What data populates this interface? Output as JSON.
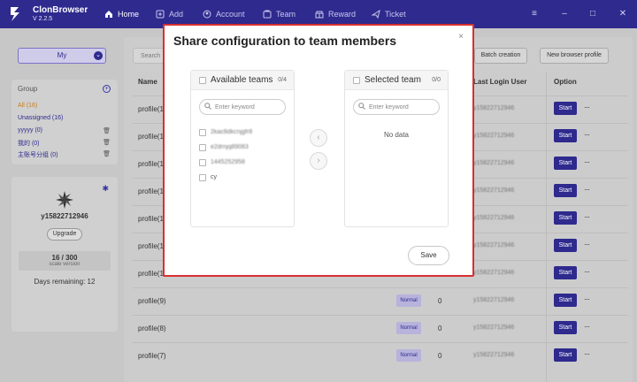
{
  "app": {
    "name": "ClonBrowser",
    "version": "V 2.2.5"
  },
  "nav": [
    {
      "label": "Home",
      "icon": "home-icon"
    },
    {
      "label": "Add",
      "icon": "add-icon"
    },
    {
      "label": "Account",
      "icon": "account-icon"
    },
    {
      "label": "Team",
      "icon": "team-icon"
    },
    {
      "label": "Reward",
      "icon": "reward-icon"
    },
    {
      "label": "Ticket",
      "icon": "ticket-icon"
    }
  ],
  "sidebar": {
    "my_label": "My",
    "group_title": "Group",
    "groups": [
      {
        "label": "All  (16)"
      },
      {
        "label": "Unassigned  (16)"
      },
      {
        "label": "yyyyy  (0)"
      },
      {
        "label": "我的  (0)"
      },
      {
        "label": "主账号分组  (0)"
      }
    ],
    "username": "y15822712946",
    "upgrade_label": "Upgrade",
    "quota_value": "16 / 300",
    "quota_caption": "scale version",
    "days_remaining": "Days remaining: 12"
  },
  "main": {
    "search_placeholder": "Search",
    "batch_label": "Batch creation",
    "new_profile_label": "New browser profile",
    "columns": {
      "name": "Name",
      "last_login": "Last Login User",
      "option": "Option"
    },
    "rows": [
      {
        "name": "profile(1",
        "status": "",
        "count": "",
        "user": "y15822712946"
      },
      {
        "name": "profile(1",
        "status": "",
        "count": "",
        "user": "y15822712946"
      },
      {
        "name": "profile(1",
        "status": "",
        "count": "",
        "user": "y15822712946"
      },
      {
        "name": "profile(1",
        "status": "",
        "count": "",
        "user": "y15822712946"
      },
      {
        "name": "profile(1",
        "status": "",
        "count": "",
        "user": "y15822712946"
      },
      {
        "name": "profile(1",
        "status": "",
        "count": "",
        "user": "y15822712946"
      },
      {
        "name": "profile(1",
        "status": "",
        "count": "",
        "user": "y15822712946"
      },
      {
        "name": "profile(9)",
        "status": "Normal",
        "count": "0",
        "user": "y15822712946"
      },
      {
        "name": "profile(8)",
        "status": "Normal",
        "count": "0",
        "user": "y15822712946"
      },
      {
        "name": "profile(7)",
        "status": "Normal",
        "count": "0",
        "user": "y15822712946"
      }
    ],
    "start_label": "Start",
    "more_label": "···"
  },
  "modal": {
    "title": "Share configuration to team members",
    "close": "×",
    "left": {
      "title": "Available teams",
      "count": "0/4",
      "placeholder": "Enter keyword",
      "items": [
        "2kac8dkcnjgfr8",
        "e2drnjq89083",
        "1445252958",
        "cy"
      ]
    },
    "right": {
      "title": "Selected team",
      "count": "0/0",
      "placeholder": "Enter keyword",
      "empty": "No data"
    },
    "move_left": "‹",
    "move_right": "›",
    "save_label": "Save"
  }
}
